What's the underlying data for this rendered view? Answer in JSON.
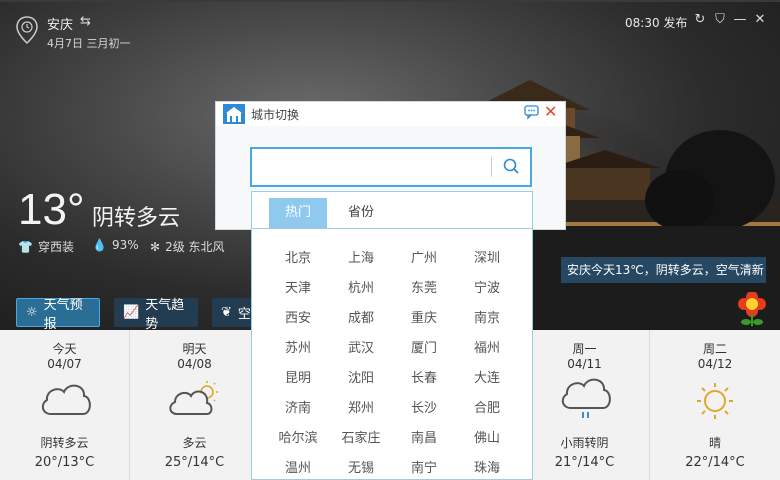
{
  "header": {
    "city": "安庆",
    "date": "4月7日 三月初一",
    "publish": "08:30 发布"
  },
  "current": {
    "temp": "13°",
    "condition": "阴转多云",
    "clothing": "穿西装",
    "humidity": "93%",
    "wind": "2级 东北风"
  },
  "nav": {
    "forecast": "天气预报",
    "trend": "天气趋势",
    "air": "空"
  },
  "toast": "安庆今天13℃，阴转多云，空气清新",
  "forecast": [
    {
      "name": "今天",
      "date": "04/07",
      "cond": "阴转多云",
      "temp": "20°/13°C",
      "icon": "cloud-icon"
    },
    {
      "name": "明天",
      "date": "04/08",
      "cond": "多云",
      "temp": "25°/14°C",
      "icon": "partly-cloudy-icon"
    },
    {
      "name": "",
      "date": "",
      "cond": "",
      "temp": "",
      "icon": ""
    },
    {
      "name": "",
      "date": "",
      "cond": "",
      "temp": "",
      "icon": ""
    },
    {
      "name": "周一",
      "date": "04/11",
      "cond": "小雨转阴",
      "temp": "21°/14°C",
      "icon": "rain-icon"
    },
    {
      "name": "周二",
      "date": "04/12",
      "cond": "晴",
      "temp": "22°/14°C",
      "icon": "sun-icon"
    }
  ],
  "dialog": {
    "title": "城市切换",
    "search_placeholder": "",
    "tabs": [
      "热门",
      "省份"
    ],
    "cities": [
      "北京",
      "上海",
      "广州",
      "深圳",
      "天津",
      "杭州",
      "东莞",
      "宁波",
      "西安",
      "成都",
      "重庆",
      "南京",
      "苏州",
      "武汉",
      "厦门",
      "福州",
      "昆明",
      "沈阳",
      "长春",
      "大连",
      "济南",
      "郑州",
      "长沙",
      "合肥",
      "哈尔滨",
      "石家庄",
      "南昌",
      "佛山",
      "温州",
      "无锡",
      "南宁",
      "珠海"
    ]
  },
  "colors": {
    "accent": "#4aa8e0",
    "tab_active": "#8fc9ee",
    "close": "#e04a2a",
    "active_nav": "#2a6e96"
  }
}
